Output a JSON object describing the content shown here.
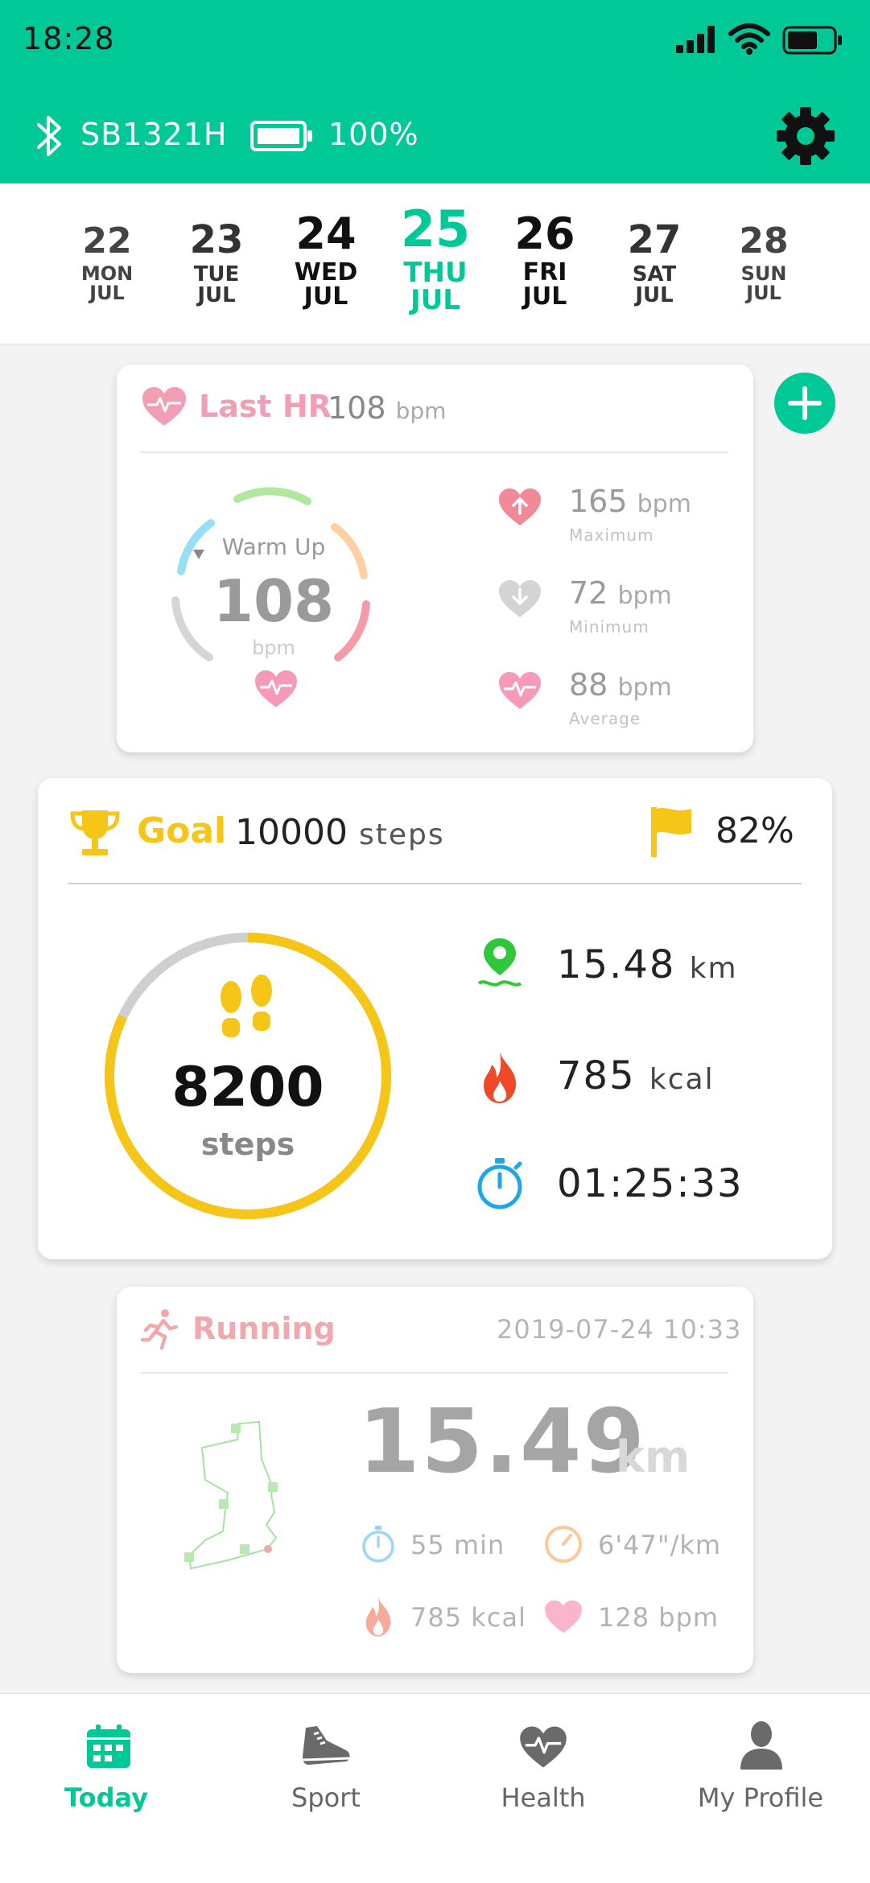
{
  "status_bar": {
    "time": "18:28"
  },
  "device": {
    "name": "SB1321H",
    "battery": "100%"
  },
  "colors": {
    "accent": "#00c896",
    "hr": "#f29fb6",
    "goal": "#f5c518",
    "running": "#f2a7ad"
  },
  "dates": [
    {
      "day": "22",
      "weekday": "MON",
      "month": "JUL"
    },
    {
      "day": "23",
      "weekday": "TUE",
      "month": "JUL"
    },
    {
      "day": "24",
      "weekday": "WED",
      "month": "JUL"
    },
    {
      "day": "25",
      "weekday": "THU",
      "month": "JUL",
      "selected": true
    },
    {
      "day": "26",
      "weekday": "FRI",
      "month": "JUL"
    },
    {
      "day": "27",
      "weekday": "SAT",
      "month": "JUL"
    },
    {
      "day": "28",
      "weekday": "SUN",
      "month": "JUL"
    }
  ],
  "hr": {
    "title": "Last HR",
    "last_value": "108",
    "unit": "bpm",
    "zone": "Warm Up",
    "gauge_value": "108",
    "gauge_unit": "bpm",
    "max": {
      "value": "165",
      "unit": "bpm",
      "label": "Maximum"
    },
    "min": {
      "value": "72",
      "unit": "bpm",
      "label": "Minimum"
    },
    "avg": {
      "value": "88",
      "unit": "bpm",
      "label": "Average"
    }
  },
  "goal": {
    "title": "Goal",
    "target": "10000",
    "target_unit": "steps",
    "percent": "82%",
    "progress_fraction": 0.82,
    "steps": "8200",
    "steps_label": "steps",
    "distance": {
      "value": "15.48",
      "unit": "km"
    },
    "calories": {
      "value": "785",
      "unit": "kcal"
    },
    "duration": "01:25:33"
  },
  "running": {
    "title": "Running",
    "datetime": "2019-07-24  10:33",
    "distance": "15.49",
    "distance_unit": "km",
    "duration": "55 min",
    "pace": "6'47\"/km",
    "calories": "785 kcal",
    "heart_rate": "128 bpm"
  },
  "tabs": [
    {
      "label": "Today",
      "icon": "calendar-icon",
      "active": true
    },
    {
      "label": "Sport",
      "icon": "shoe-icon"
    },
    {
      "label": "Health",
      "icon": "heart-pulse-icon"
    },
    {
      "label": "My Profile",
      "icon": "person-icon"
    }
  ]
}
